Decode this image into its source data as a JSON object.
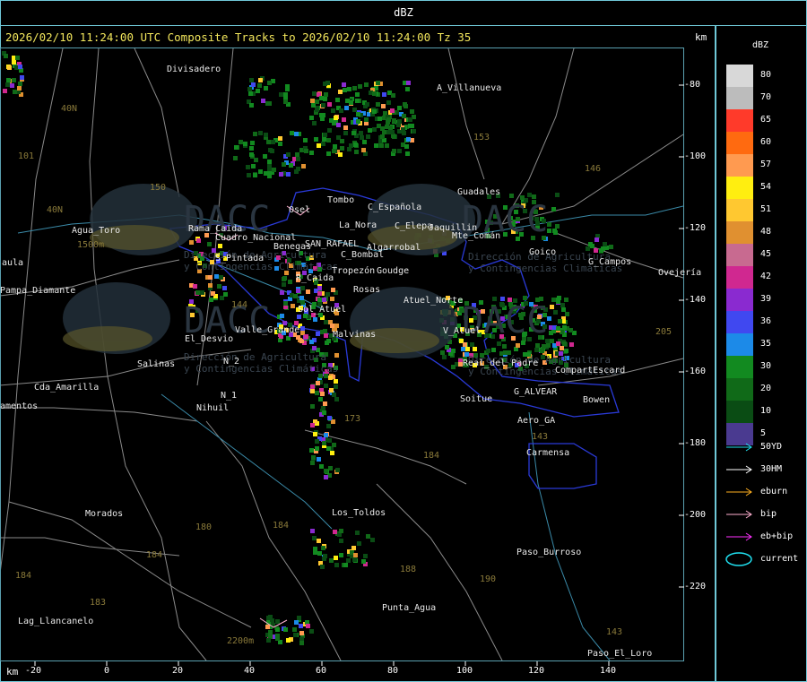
{
  "window": {
    "title": "dBZ"
  },
  "map": {
    "title": "2026/02/10 11:24:00 UTC Composite Tracks to 2026/02/10 11:24:00 Tz 35",
    "unit_top": "km",
    "unit_bottom": "km",
    "x_ticks": [
      "-20",
      "0",
      "20",
      "40",
      "60",
      "80",
      "100",
      "120",
      "140"
    ],
    "y_ticks": [
      "-80",
      "-100",
      "-120",
      "-140",
      "-160",
      "-180",
      "-200",
      "-220"
    ],
    "places": [
      {
        "name": "Divisadero"
      },
      {
        "name": "A_Villanueva"
      },
      {
        "name": "40N"
      },
      {
        "name": "101"
      },
      {
        "name": "150"
      },
      {
        "name": "153"
      },
      {
        "name": "146"
      },
      {
        "name": "40N"
      },
      {
        "name": "Agua_Toro"
      },
      {
        "name": "1500m"
      },
      {
        "name": "Tombo"
      },
      {
        "name": "C_Española"
      },
      {
        "name": "Guadales"
      },
      {
        "name": "Osel"
      },
      {
        "name": "La_Nora"
      },
      {
        "name": "C_Elepa"
      },
      {
        "name": "Jaquillin"
      },
      {
        "name": "Rama_Caida"
      },
      {
        "name": "Cuadro_Nacional"
      },
      {
        "name": "Mte_Comán"
      },
      {
        "name": "Goico"
      },
      {
        "name": "G_Campos"
      },
      {
        "name": "Ovejería"
      },
      {
        "name": "aula"
      },
      {
        "name": "Pampa_Diamante"
      },
      {
        "name": "S_Pintada"
      },
      {
        "name": "Benegas"
      },
      {
        "name": "SAN_RAFAEL"
      },
      {
        "name": "Algarrobal"
      },
      {
        "name": "C_Bombal"
      },
      {
        "name": "Tropezón"
      },
      {
        "name": "Goudge"
      },
      {
        "name": "R_Caida"
      },
      {
        "name": "Rosas"
      },
      {
        "name": "Atuel_Norte"
      },
      {
        "name": "Sol_Atuel"
      },
      {
        "name": "144"
      },
      {
        "name": "El_Desvio"
      },
      {
        "name": "Valle_Grande"
      },
      {
        "name": "Malvinas"
      },
      {
        "name": "V_Atuel"
      },
      {
        "name": "205"
      },
      {
        "name": "Salinas"
      },
      {
        "name": "N_2"
      },
      {
        "name": "Real_del_Padre"
      },
      {
        "name": "CompartEscard"
      },
      {
        "name": "Cda_Amarilla"
      },
      {
        "name": "N_1"
      },
      {
        "name": "G_ALVEAR"
      },
      {
        "name": "amentos"
      },
      {
        "name": "Nihuil"
      },
      {
        "name": "Soitue"
      },
      {
        "name": "Bowen"
      },
      {
        "name": "173"
      },
      {
        "name": "Aero_GA"
      },
      {
        "name": "143"
      },
      {
        "name": "184"
      },
      {
        "name": "Carmensa"
      },
      {
        "name": "Morados"
      },
      {
        "name": "Los_Toldos"
      },
      {
        "name": "180"
      },
      {
        "name": "184"
      },
      {
        "name": "184"
      },
      {
        "name": "Paso_Burroso"
      },
      {
        "name": "184"
      },
      {
        "name": "188"
      },
      {
        "name": "190"
      },
      {
        "name": "183"
      },
      {
        "name": "Punta_Agua"
      },
      {
        "name": "Lag_Llancanelo"
      },
      {
        "name": "2200m"
      },
      {
        "name": "143"
      },
      {
        "name": "Paso_El_Loro"
      }
    ],
    "watermark": {
      "line1": "Dirección de Agricultura",
      "line2": "y Contingencias Climáticas",
      "brand": "DACC"
    }
  },
  "legend": {
    "title": "dBZ",
    "scale": [
      {
        "label": "80",
        "color": "#d8d8d8"
      },
      {
        "label": "70",
        "color": "#bcbcbc"
      },
      {
        "label": "65",
        "color": "#ff3a2a"
      },
      {
        "label": "60",
        "color": "#ff6a10"
      },
      {
        "label": "57",
        "color": "#ff9a50"
      },
      {
        "label": "54",
        "color": "#ffee10"
      },
      {
        "label": "51",
        "color": "#ffc830"
      },
      {
        "label": "48",
        "color": "#e09030"
      },
      {
        "label": "45",
        "color": "#c86a90"
      },
      {
        "label": "42",
        "color": "#d02890"
      },
      {
        "label": "39",
        "color": "#8a2ad0"
      },
      {
        "label": "36",
        "color": "#4048f0"
      },
      {
        "label": "35",
        "color": "#1c8ae8"
      },
      {
        "label": "30",
        "color": "#128a20"
      },
      {
        "label": "20",
        "color": "#106a18"
      },
      {
        "label": "10",
        "color": "#0a4c14"
      },
      {
        "label": "5",
        "color": "#4a3a90"
      }
    ],
    "tracks": [
      {
        "label": "50YD",
        "color": "#20e0f0",
        "shape": "arrow"
      },
      {
        "label": "30HM",
        "color": "#ffffff",
        "shape": "arrow"
      },
      {
        "label": "eburn",
        "color": "#ffb020",
        "shape": "arrow"
      },
      {
        "label": "bip",
        "color": "#ffb0d0",
        "shape": "arrow"
      },
      {
        "label": "eb+bip",
        "color": "#ff30ff",
        "shape": "arrow"
      },
      {
        "label": "current",
        "color": "#20e0f0",
        "shape": "ellipse"
      }
    ]
  }
}
